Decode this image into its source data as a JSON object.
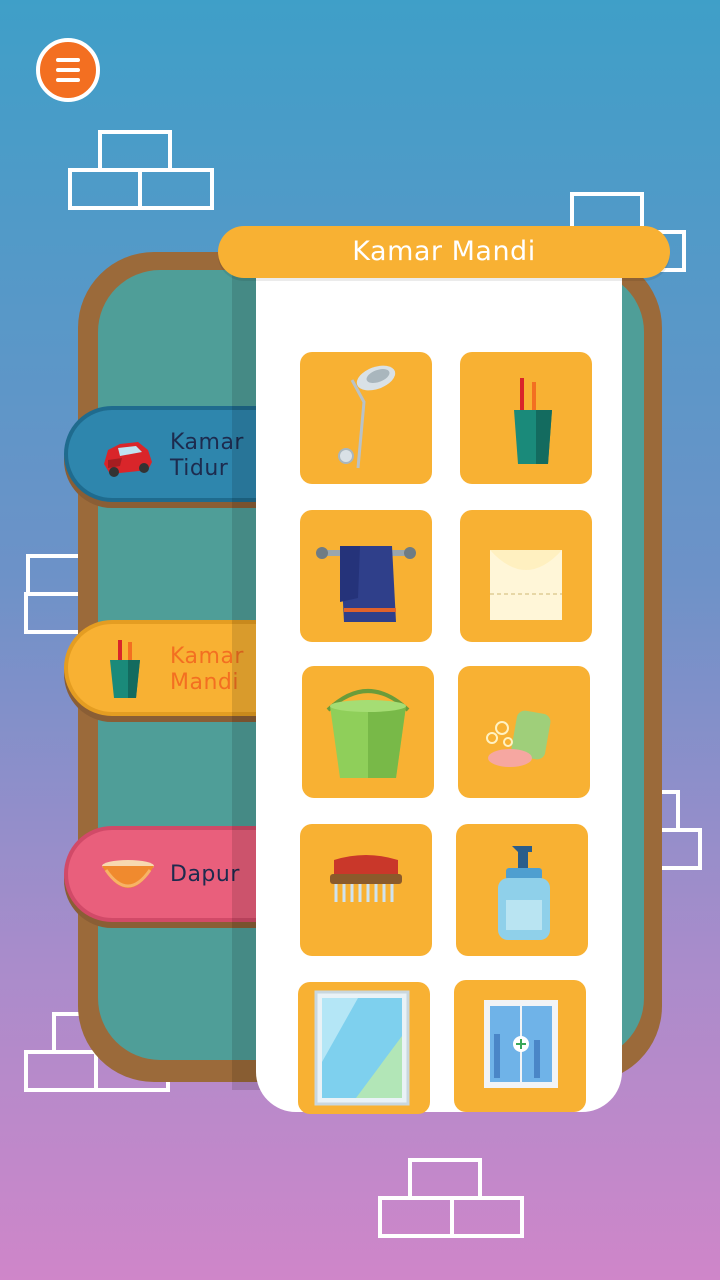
{
  "screen": {
    "title": "Kamar Mandi"
  },
  "categories": [
    {
      "label_line1": "Kamar",
      "label_line2": "Tidur",
      "icon": "car-icon",
      "color": "#2e86ad",
      "text_color": "#1d2b4e"
    },
    {
      "label_line1": "Kamar",
      "label_line2": "Mandi",
      "icon": "toothbrush-cup-icon",
      "color": "#f8b133",
      "text_color": "#f36f21",
      "selected": true
    },
    {
      "label_line1": "Dapur",
      "label_line2": "",
      "icon": "bowl-icon",
      "color": "#e95f7c",
      "text_color": "#1d2b4e"
    }
  ],
  "items": [
    {
      "icon": "shower-head-icon"
    },
    {
      "icon": "toothbrush-cup-icon"
    },
    {
      "icon": "towel-icon"
    },
    {
      "icon": "tissue-box-icon"
    },
    {
      "icon": "bucket-icon"
    },
    {
      "icon": "soap-icon"
    },
    {
      "icon": "scrub-brush-icon"
    },
    {
      "icon": "soap-dispenser-icon"
    },
    {
      "icon": "mirror-icon"
    },
    {
      "icon": "bathroom-cabinet-icon"
    }
  ],
  "colors": {
    "accent": "#f8b133",
    "menu": "#f36f21",
    "board": "#4f9e98",
    "board_frame": "#9b6a3a"
  }
}
